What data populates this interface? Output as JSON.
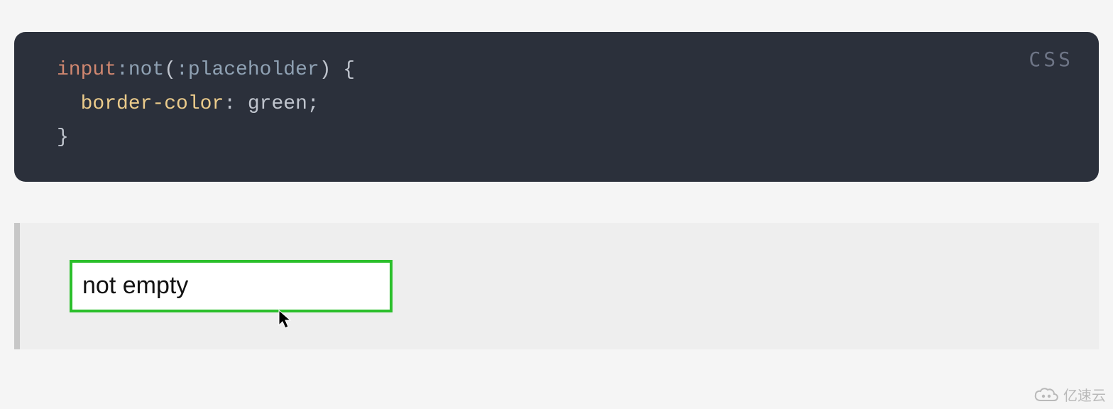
{
  "code": {
    "language": "CSS",
    "selector_tag": "input",
    "pseudo_open": ":not",
    "pseudo_inner": ":placeholder",
    "brace_open": " {",
    "indent": "  ",
    "property": "border-color",
    "colon": ":",
    "value": " green",
    "semicolon": ";",
    "brace_close": "}"
  },
  "demo": {
    "input_value": "not empty",
    "border_color": "#2bbf2b"
  },
  "watermark": {
    "text": "亿速云"
  }
}
